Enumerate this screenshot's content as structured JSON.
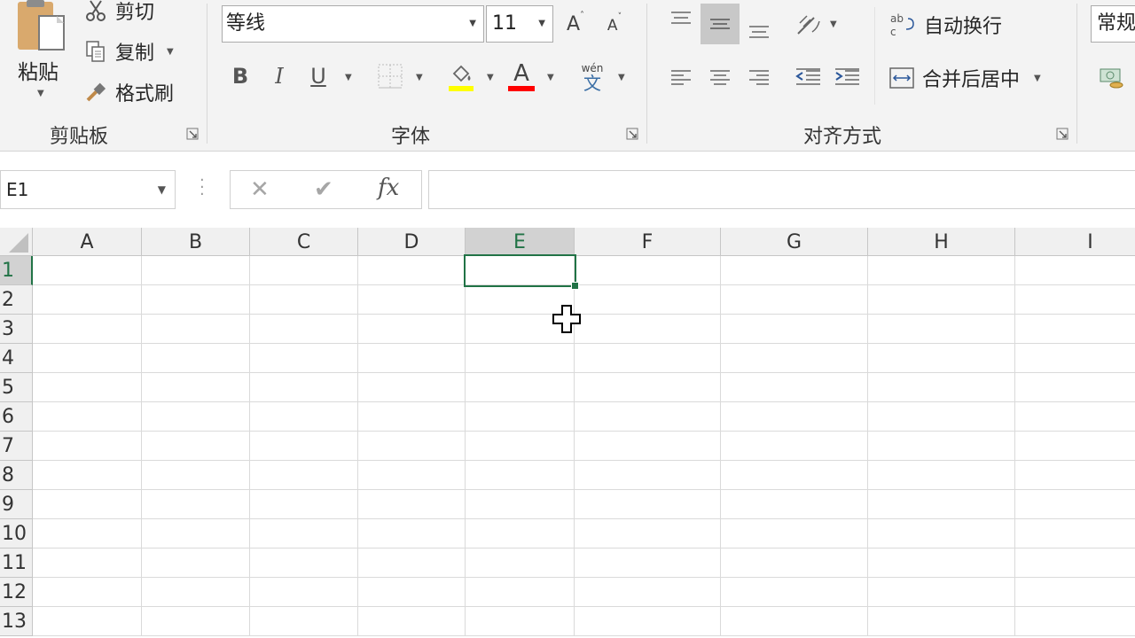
{
  "clipboard": {
    "paste_label": "粘贴",
    "cut_label": "剪切",
    "copy_label": "复制",
    "format_painter_label": "格式刷",
    "group_label": "剪贴板"
  },
  "font": {
    "name_value": "等线",
    "size_value": "11",
    "group_label": "字体",
    "bold": "B",
    "italic": "I",
    "underline": "U",
    "font_color_glyph": "A",
    "phonetic_top": "wén",
    "phonetic_bottom": "文"
  },
  "alignment": {
    "wrap_text_label": "自动换行",
    "merge_label": "合并后居中",
    "group_label": "对齐方式"
  },
  "number": {
    "format_value": "常规"
  },
  "formula_bar": {
    "name_box_value": "E1",
    "cancel_glyph": "✕",
    "enter_glyph": "✔",
    "fx_label": "fx",
    "formula_value": ""
  },
  "sheet": {
    "columns": [
      "A",
      "B",
      "C",
      "D",
      "E",
      "F",
      "G",
      "H",
      "I"
    ],
    "rows": [
      "1",
      "2",
      "3",
      "4",
      "5",
      "6",
      "7",
      "8",
      "9",
      "10",
      "11",
      "12",
      "13"
    ],
    "active_cell": "E1"
  },
  "colors": {
    "accent": "#217346",
    "ribbon_bg": "#f3f3f3"
  }
}
